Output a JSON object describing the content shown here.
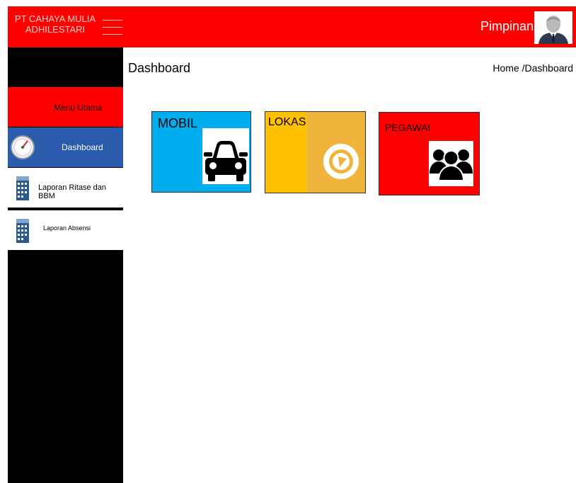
{
  "header": {
    "brand_line1": "PT CAHAYA MULIA",
    "brand_line2": "ADHILESTARI",
    "user_label": "Pimpinan"
  },
  "sidebar": {
    "menu_title": "Menu Utama",
    "items": [
      {
        "label": "Dashboard",
        "icon": "gauge-icon",
        "active": true
      },
      {
        "label": "Laporan Ritase dan BBM",
        "icon": "calendar-icon",
        "active": false
      },
      {
        "label": "Laporan Absensi",
        "icon": "calendar-icon",
        "active": false
      }
    ]
  },
  "main": {
    "title": "Dashboard",
    "breadcrumb": "Home /Dashboard",
    "cards": [
      {
        "label": "MOBIL",
        "icon": "car-icon",
        "color": "#00adef"
      },
      {
        "label": "LOKASI",
        "icon": "location-icon",
        "color": "#ffc000"
      },
      {
        "label": "PEGAWAI",
        "icon": "users-icon",
        "color": "#ff0000"
      }
    ]
  },
  "colors": {
    "header_bg": "#ff0000",
    "sidebar_bg": "#000000",
    "active_item_bg": "#2a5bad"
  }
}
